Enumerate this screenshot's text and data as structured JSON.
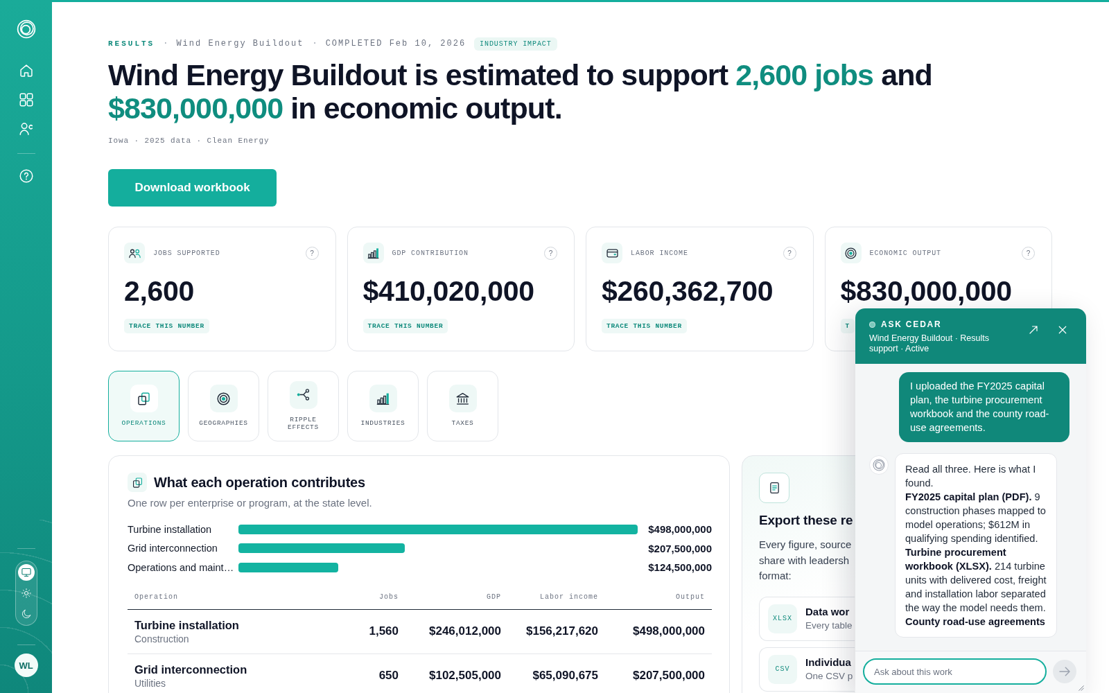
{
  "sidebar": {
    "theme_options": [
      {
        "kind": "system",
        "selected": true
      },
      {
        "kind": "light",
        "selected": false
      },
      {
        "kind": "dark",
        "selected": false
      }
    ],
    "avatar_initials": "WL"
  },
  "breadcrumb": [
    {
      "kind": "section",
      "text": "RESULTS"
    },
    {
      "kind": "separator",
      "text": "·"
    },
    {
      "kind": "plain",
      "text": "Wind Energy Buildout"
    },
    {
      "kind": "separator",
      "text": "·"
    },
    {
      "kind": "plain",
      "text": "COMPLETED Feb 10, 2026"
    },
    {
      "kind": "badge",
      "text": "INDUSTRY IMPACT"
    }
  ],
  "headline": "Wind Energy Buildout is estimated to support **2,600 jobs** and **$830,000,000** in economic output.",
  "meta": "Iowa · 2025 data · Clean Energy",
  "download_button": "Download workbook",
  "kpis": [
    {
      "kind": "jobs",
      "label": "JOBS SUPPORTED",
      "help": "?",
      "value": "2,600",
      "trace": "TRACE THIS NUMBER"
    },
    {
      "kind": "gdp",
      "label": "GDP CONTRIBUTION",
      "help": "?",
      "value": "$410,020,000",
      "trace": "TRACE THIS NUMBER"
    },
    {
      "kind": "income",
      "label": "LABOR INCOME",
      "help": "?",
      "value": "$260,362,700",
      "trace": "TRACE THIS NUMBER"
    },
    {
      "kind": "output",
      "label": "ECONOMIC OUTPUT",
      "help": "?",
      "value": "$830,000,000",
      "trace": "T"
    }
  ],
  "tabs": [
    {
      "kind": "operations",
      "label": "OPERATIONS",
      "selected": true
    },
    {
      "kind": "geographies",
      "label": "GEOGRAPHIES",
      "selected": false
    },
    {
      "kind": "ripple",
      "label": "RIPPLE EFFECTS",
      "selected": false
    },
    {
      "kind": "industries",
      "label": "INDUSTRIES",
      "selected": false
    },
    {
      "kind": "taxes",
      "label": "TAXES",
      "selected": false
    }
  ],
  "operations": {
    "title": "What each operation contributes",
    "subtitle": "One row per enterprise or program, at the state level.",
    "chart_data": {
      "type": "bar",
      "orientation": "horizontal",
      "categories": [
        "Turbine installation",
        "Grid interconnection",
        "Operations and maint…"
      ],
      "values": [
        498000000,
        207500000,
        124500000
      ],
      "value_labels": [
        "$498,000,000",
        "$207,500,000",
        "$124,500,000"
      ]
    },
    "table": {
      "columns": [
        "Operation",
        "Jobs",
        "GDP",
        "Labor income",
        "Output"
      ],
      "rows": [
        {
          "operation": "Turbine installation",
          "category": "Construction",
          "jobs": "1,560",
          "gdp": "$246,012,000",
          "labor_income": "$156,217,620",
          "output": "$498,000,000"
        },
        {
          "operation": "Grid interconnection",
          "category": "Utilities",
          "jobs": "650",
          "gdp": "$102,505,000",
          "labor_income": "$65,090,675",
          "output": "$207,500,000"
        }
      ]
    }
  },
  "export": {
    "title": "Export these re",
    "description": "Every figure, source\nshare with leadersh\nformat:",
    "options": [
      {
        "format": "XLSX",
        "title": "Data wor",
        "subtitle": "Every table"
      },
      {
        "format": "CSV",
        "title": "Individua",
        "subtitle": "One CSV p"
      }
    ]
  },
  "chat": {
    "title": "ASK CEDAR",
    "subtitle": "Wind Energy Buildout · Results support · Active",
    "messages": [
      {
        "kind": "user",
        "paragraphs": [
          {
            "text": "I uploaded the FY2025 capital plan, the turbine procurement workbook and the county road-use agreements."
          }
        ]
      },
      {
        "kind": "assistant",
        "paragraphs": [
          {
            "text": "Read all three. Here is what I found."
          },
          {
            "lead": "FY2025 capital plan (PDF).",
            "text": "9 construction phases mapped to model operations; $612M in qualifying spending identified."
          },
          {
            "lead": "Turbine procurement workbook (XLSX).",
            "text": "214 turbine units with delivered cost, freight and installation labor separated the way the model needs them."
          },
          {
            "lead": "County road-use agreements"
          }
        ]
      }
    ],
    "input": {
      "placeholder": "Ask about this work"
    }
  }
}
